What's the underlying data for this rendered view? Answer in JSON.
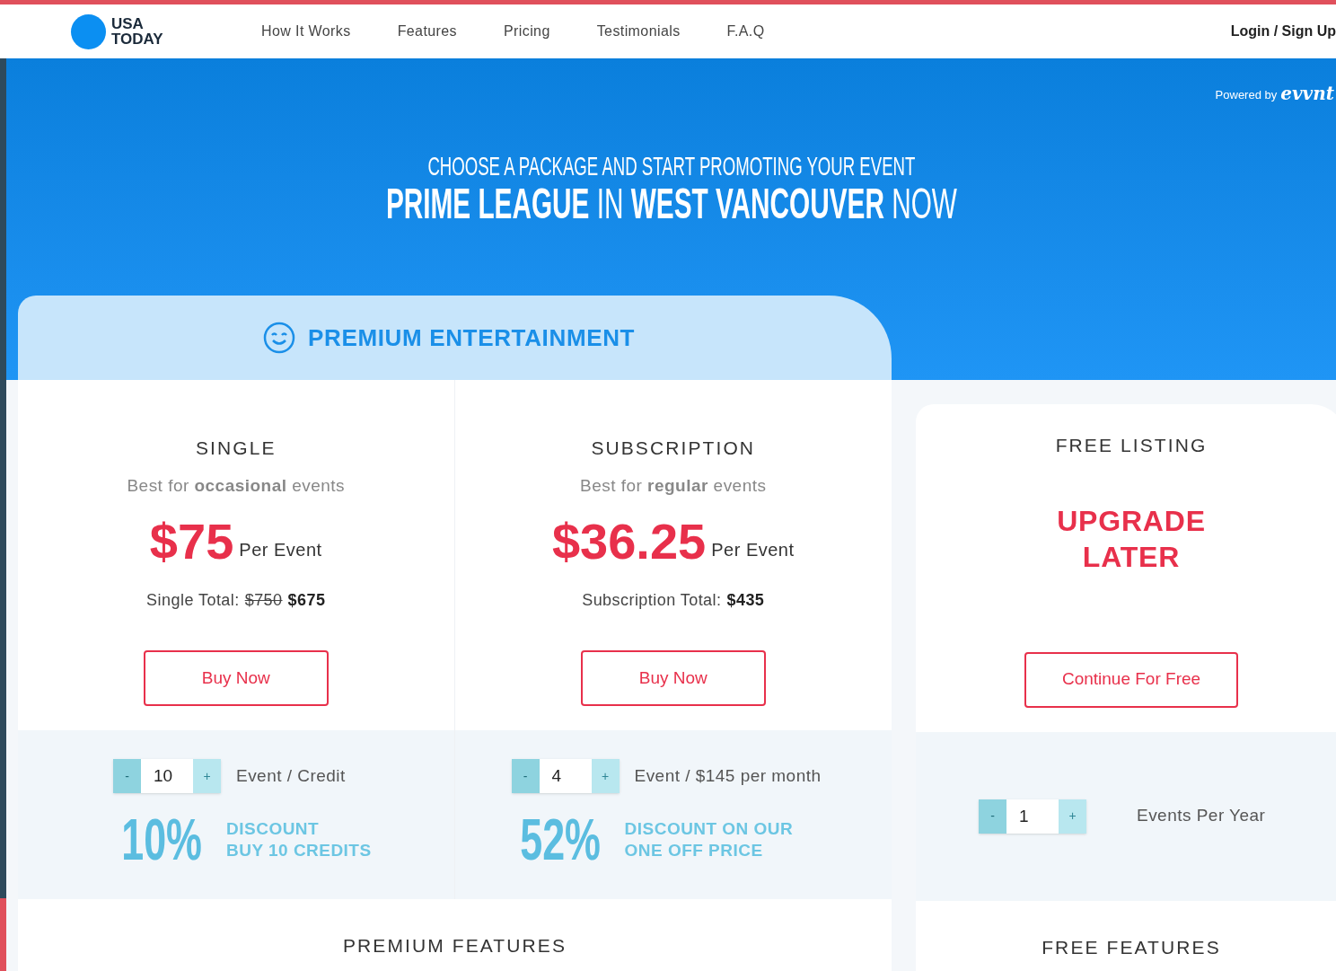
{
  "nav": {
    "logo": [
      "USA",
      "TODAY"
    ],
    "links": [
      "How It Works",
      "Features",
      "Pricing",
      "Testimonials",
      "F.A.Q"
    ],
    "login": "Login / Sign Up"
  },
  "hero": {
    "powered_by": "Powered by",
    "brand": "evvnt",
    "subtitle": "CHOOSE A PACKAGE AND START PROMOTING YOUR  EVENT",
    "title": "**PRIME LEAGUE** IN **WEST VANCOUVER** NOW"
  },
  "premium": {
    "title": "PREMIUM ENTERTAINMENT",
    "plans": [
      {
        "name": "SINGLE",
        "tagline": "Best for **occasional** events",
        "price": "$75",
        "unit": "Per Event",
        "total_label": "Single Total:",
        "old_total": "$750",
        "total": "$675",
        "button": "Buy Now",
        "minus": "-",
        "quantity": "10",
        "plus": "+",
        "quantity_label": "Event / Credit",
        "percent": "10%",
        "discount": [
          "DISCOUNT",
          "BUY 10 CREDITS"
        ]
      },
      {
        "name": "SUBSCRIPTION",
        "tagline": "Best for **regular** events",
        "price": "$36.25",
        "unit": "Per Event",
        "total_label": "Subscription Total:",
        "total": "$435",
        "button": "Buy Now",
        "minus": "-",
        "quantity": "4",
        "plus": "+",
        "quantity_label": "Event / $145 per month",
        "percent": "52%",
        "discount": [
          "DISCOUNT ON OUR",
          "ONE OFF PRICE"
        ]
      }
    ],
    "features": "PREMIUM FEATURES"
  },
  "free": {
    "name": "FREE LISTING",
    "headline": [
      "UPGRADE",
      "LATER"
    ],
    "button": "Continue For Free",
    "minus": "-",
    "quantity": "1",
    "plus": "+",
    "quantity_label": "Events Per Year",
    "features": "FREE FEATURES"
  }
}
